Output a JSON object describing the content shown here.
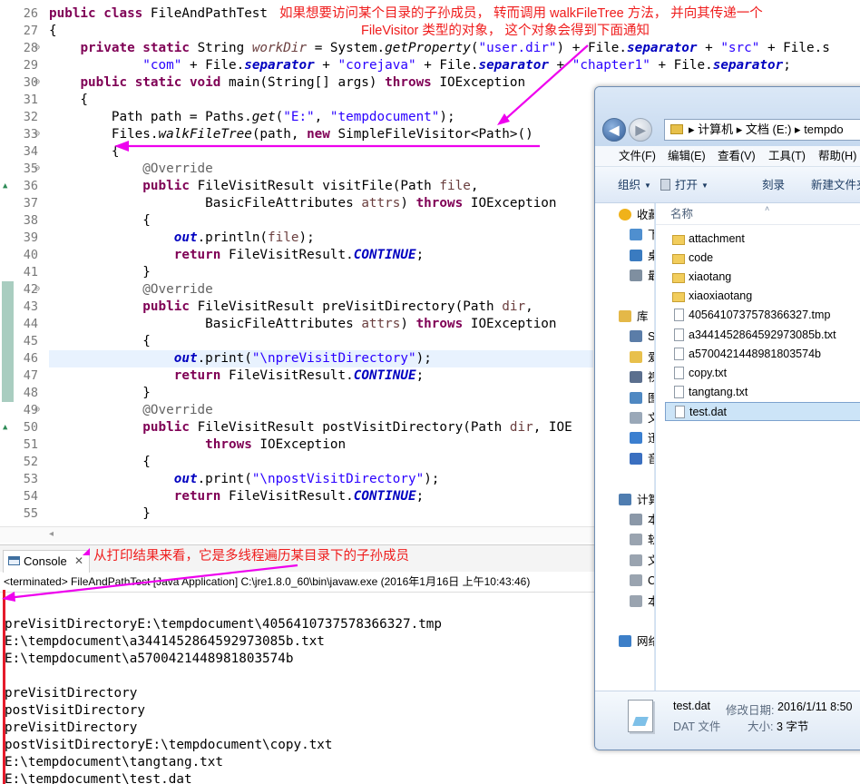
{
  "editor": {
    "lines": [
      {
        "num": "26",
        "fold": "",
        "ov": false
      },
      {
        "num": "27",
        "fold": "",
        "ov": false
      },
      {
        "num": "28",
        "fold": "⊖",
        "ov": false
      },
      {
        "num": "29",
        "fold": "",
        "ov": false
      },
      {
        "num": "30",
        "fold": "⊖",
        "ov": false
      },
      {
        "num": "31",
        "fold": "",
        "ov": false
      },
      {
        "num": "32",
        "fold": "",
        "ov": false
      },
      {
        "num": "33",
        "fold": "⊖",
        "ov": false
      },
      {
        "num": "34",
        "fold": "",
        "ov": false
      },
      {
        "num": "35",
        "fold": "⊖",
        "ov": false
      },
      {
        "num": "36",
        "fold": "",
        "ov": true
      },
      {
        "num": "37",
        "fold": "",
        "ov": false
      },
      {
        "num": "38",
        "fold": "",
        "ov": false
      },
      {
        "num": "39",
        "fold": "",
        "ov": false
      },
      {
        "num": "40",
        "fold": "",
        "ov": false
      },
      {
        "num": "41",
        "fold": "",
        "ov": false
      },
      {
        "num": "42",
        "fold": "⊖",
        "ov": false
      },
      {
        "num": "43",
        "fold": "",
        "ov": true
      },
      {
        "num": "44",
        "fold": "",
        "ov": false
      },
      {
        "num": "45",
        "fold": "",
        "ov": false
      },
      {
        "num": "46",
        "fold": "",
        "ov": false
      },
      {
        "num": "47",
        "fold": "",
        "ov": false
      },
      {
        "num": "48",
        "fold": "",
        "ov": false
      },
      {
        "num": "49",
        "fold": "⊖",
        "ov": false
      },
      {
        "num": "50",
        "fold": "",
        "ov": true
      },
      {
        "num": "51",
        "fold": "",
        "ov": false
      },
      {
        "num": "52",
        "fold": "",
        "ov": false
      },
      {
        "num": "53",
        "fold": "",
        "ov": false
      },
      {
        "num": "54",
        "fold": "",
        "ov": false
      },
      {
        "num": "55",
        "fold": "",
        "ov": false
      }
    ],
    "code": [
      [
        [
          "k",
          "public class "
        ],
        [
          "",
          "FileAndPathTest"
        ]
      ],
      [
        [
          "",
          "{"
        ]
      ],
      [
        [
          "",
          "    "
        ],
        [
          "k",
          "private static "
        ],
        [
          "",
          "String "
        ],
        [
          "vi",
          "workDir"
        ],
        [
          "",
          " = System."
        ],
        [
          "st",
          "getProperty"
        ],
        [
          "",
          "("
        ],
        [
          "s",
          "\"user.dir\""
        ],
        [
          "",
          ") + File."
        ],
        [
          "f",
          "separator"
        ],
        [
          "",
          " + "
        ],
        [
          "s",
          "\"src\""
        ],
        [
          "",
          " + File.s"
        ]
      ],
      [
        [
          "",
          "            "
        ],
        [
          "s",
          "\"com\""
        ],
        [
          "",
          " + File."
        ],
        [
          "f",
          "separator"
        ],
        [
          "",
          " + "
        ],
        [
          "s",
          "\"corejava\""
        ],
        [
          "",
          " + File."
        ],
        [
          "f",
          "separator"
        ],
        [
          "",
          " + "
        ],
        [
          "s",
          "\"chapter1\""
        ],
        [
          "",
          " + File."
        ],
        [
          "f",
          "separator"
        ],
        [
          "",
          ";"
        ]
      ],
      [
        [
          "",
          "    "
        ],
        [
          "k",
          "public static void "
        ],
        [
          "",
          "main(String[] args) "
        ],
        [
          "k",
          "throws "
        ],
        [
          "",
          "IOException"
        ]
      ],
      [
        [
          "",
          "    {"
        ]
      ],
      [
        [
          "",
          "        Path path = Paths."
        ],
        [
          "st",
          "get"
        ],
        [
          "",
          "("
        ],
        [
          "s",
          "\"E:\""
        ],
        [
          "",
          ", "
        ],
        [
          "s",
          "\"tempdocument\""
        ],
        [
          "",
          ");"
        ]
      ],
      [
        [
          "",
          "        Files."
        ],
        [
          "st",
          "walkFileTree"
        ],
        [
          "",
          "(path, "
        ],
        [
          "k",
          "new "
        ],
        [
          "",
          "SimpleFileVisitor<Path>()"
        ]
      ],
      [
        [
          "",
          "        {"
        ]
      ],
      [
        [
          "",
          "            "
        ],
        [
          "ann",
          "@Override"
        ]
      ],
      [
        [
          "",
          "            "
        ],
        [
          "k",
          "public "
        ],
        [
          "",
          "FileVisitResult visitFile(Path "
        ],
        [
          "vp",
          "file"
        ],
        [
          "",
          ","
        ]
      ],
      [
        [
          "",
          "                    BasicFileAttributes "
        ],
        [
          "vp",
          "attrs"
        ],
        [
          "",
          ") "
        ],
        [
          "k",
          "throws "
        ],
        [
          "",
          "IOException"
        ]
      ],
      [
        [
          "",
          "            {"
        ]
      ],
      [
        [
          "",
          "                "
        ],
        [
          "fi",
          "out"
        ],
        [
          "",
          ".println("
        ],
        [
          "vp",
          "file"
        ],
        [
          "",
          ");"
        ]
      ],
      [
        [
          "",
          "                "
        ],
        [
          "k",
          "return "
        ],
        [
          "",
          "FileVisitResult."
        ],
        [
          "fi",
          "CONTINUE"
        ],
        [
          "",
          ";"
        ]
      ],
      [
        [
          "",
          "            }"
        ]
      ],
      [
        [
          "",
          "            "
        ],
        [
          "ann",
          "@Override"
        ]
      ],
      [
        [
          "",
          "            "
        ],
        [
          "k",
          "public "
        ],
        [
          "",
          "FileVisitResult preVisitDirectory(Path "
        ],
        [
          "vp",
          "dir"
        ],
        [
          "",
          ","
        ]
      ],
      [
        [
          "",
          "                    BasicFileAttributes "
        ],
        [
          "vp",
          "attrs"
        ],
        [
          "",
          ") "
        ],
        [
          "k",
          "throws "
        ],
        [
          "",
          "IOException"
        ]
      ],
      [
        [
          "",
          "            {"
        ]
      ],
      [
        [
          "",
          "                "
        ],
        [
          "fi",
          "out"
        ],
        [
          "",
          ".print("
        ],
        [
          "s",
          "\"\\npreVisitDirectory\""
        ],
        [
          "",
          ");"
        ]
      ],
      [
        [
          "",
          "                "
        ],
        [
          "k",
          "return "
        ],
        [
          "",
          "FileVisitResult."
        ],
        [
          "fi",
          "CONTINUE"
        ],
        [
          "",
          ";"
        ]
      ],
      [
        [
          "",
          "            }"
        ]
      ],
      [
        [
          "",
          "            "
        ],
        [
          "ann",
          "@Override"
        ]
      ],
      [
        [
          "",
          "            "
        ],
        [
          "k",
          "public "
        ],
        [
          "",
          "FileVisitResult postVisitDirectory(Path "
        ],
        [
          "vp",
          "dir"
        ],
        [
          "",
          ", IOE"
        ]
      ],
      [
        [
          "",
          "                    "
        ],
        [
          "k",
          "throws "
        ],
        [
          "",
          "IOException"
        ]
      ],
      [
        [
          "",
          "            {"
        ]
      ],
      [
        [
          "",
          "                "
        ],
        [
          "fi",
          "out"
        ],
        [
          "",
          ".print("
        ],
        [
          "s",
          "\"\\npostVisitDirectory\""
        ],
        [
          "",
          ");"
        ]
      ],
      [
        [
          "",
          "                "
        ],
        [
          "k",
          "return "
        ],
        [
          "",
          "FileVisitResult."
        ],
        [
          "fi",
          "CONTINUE"
        ],
        [
          "",
          ";"
        ]
      ],
      [
        [
          "",
          "            }"
        ]
      ]
    ]
  },
  "annotations": {
    "top_line1": "如果想要访问某个目录的子孙成员， 转而调用 walkFileTree 方法， 并向其传递一个",
    "top_line2": "FileVisitor 类型的对象， 这个对象会得到下面通知",
    "console_note": "从打印结果来看，它是多线程遍历某目录下的子孙成员"
  },
  "console": {
    "tab_label": "Console",
    "tab_close": "✕",
    "status": "<terminated> FileAndPathTest [Java Application] C:\\jre1.8.0_60\\bin\\javaw.exe (2016年1月16日 上午10:43:46)",
    "lines": [
      "",
      "preVisitDirectoryE:\\tempdocument\\405641073757836​6327.tmp",
      "E:\\tempdocument\\a3441452864592973085b.txt",
      "E:\\tempdocument\\a5700421448981803574b",
      "",
      "preVisitDirectory",
      "postVisitDirectory",
      "preVisitDirectory",
      "postVisitDirectoryE:\\tempdocument\\copy.txt",
      "E:\\tempdocument\\tangtang.txt",
      "E:\\tempdocument\\test.dat"
    ]
  },
  "explorer": {
    "breadcrumb": "▸  计算机  ▸  文档 (E:)  ▸  tempdo",
    "back_glyph": "◀",
    "fwd_glyph": "▶",
    "menu": [
      "文件(F)",
      "编辑(E)",
      "查看(V)",
      "工具(T)",
      "帮助(H)"
    ],
    "toolbar": {
      "organize": "组织",
      "open": "打开",
      "burn": "刻录",
      "new_folder": "新建文件夹"
    },
    "nav_items": [
      {
        "label": "收藏",
        "icon": "star-icon",
        "color": "#f0b21a"
      },
      {
        "label": "下",
        "icon": "download-icon",
        "color": "#4f8fcf"
      },
      {
        "label": "桌",
        "icon": "desktop-icon",
        "color": "#3a7bc0"
      },
      {
        "label": "最",
        "icon": "recent-icon",
        "color": "#7f8fa0"
      },
      {
        "label": "",
        "icon": "",
        "color": ""
      },
      {
        "label": "库",
        "icon": "library-icon",
        "color": "#e4b848"
      },
      {
        "label": "S",
        "icon": "video-lib-icon",
        "color": "#5b7da8"
      },
      {
        "label": "爱",
        "icon": "folder-icon",
        "color": "#e8c04c"
      },
      {
        "label": "视",
        "icon": "video-icon",
        "color": "#5b6f8e"
      },
      {
        "label": "图",
        "icon": "picture-icon",
        "color": "#4f88c2"
      },
      {
        "label": "文",
        "icon": "document-icon",
        "color": "#9aa8b8"
      },
      {
        "label": "迅",
        "icon": "thunder-icon",
        "color": "#3b7fd0"
      },
      {
        "label": "音",
        "icon": "music-icon",
        "color": "#3a6fc0"
      },
      {
        "label": "",
        "icon": "",
        "color": ""
      },
      {
        "label": "计算",
        "icon": "computer-icon",
        "color": "#4f7db0"
      },
      {
        "label": "本",
        "icon": "drive-c-icon",
        "color": "#8b98a8"
      },
      {
        "label": "软",
        "icon": "drive-icon",
        "color": "#9aa4b0"
      },
      {
        "label": "文",
        "icon": "drive-icon",
        "color": "#9aa4b0"
      },
      {
        "label": "C",
        "icon": "drive-icon",
        "color": "#9aa4b0"
      },
      {
        "label": "本",
        "icon": "drive-icon",
        "color": "#9aa4b0"
      },
      {
        "label": "",
        "icon": "",
        "color": ""
      },
      {
        "label": "网络",
        "icon": "network-icon",
        "color": "#3d7fc8"
      }
    ],
    "column_header": "名称",
    "files": [
      {
        "name": "attachment",
        "type": "folder"
      },
      {
        "name": "code",
        "type": "folder"
      },
      {
        "name": "xiaotang",
        "type": "folder"
      },
      {
        "name": "xiaoxiaotang",
        "type": "folder"
      },
      {
        "name": "4056410737578366327.tmp",
        "type": "file"
      },
      {
        "name": "a3441452864592973085b.txt",
        "type": "file"
      },
      {
        "name": "a5700421448981803574b",
        "type": "file"
      },
      {
        "name": "copy.txt",
        "type": "file"
      },
      {
        "name": "tangtang.txt",
        "type": "file"
      },
      {
        "name": "test.dat",
        "type": "file",
        "selected": true
      }
    ],
    "details": {
      "name": "test.dat",
      "type": "DAT 文件",
      "modified_label": "修改日期:",
      "modified_value": "2016/1/11 8:50",
      "size_label": "大小:",
      "size_value": "3 字节"
    }
  },
  "colors": {
    "annotation": "#ef1c1c",
    "keyword": "#7f0055",
    "string": "#2a00ff",
    "field": "#0000c0"
  }
}
